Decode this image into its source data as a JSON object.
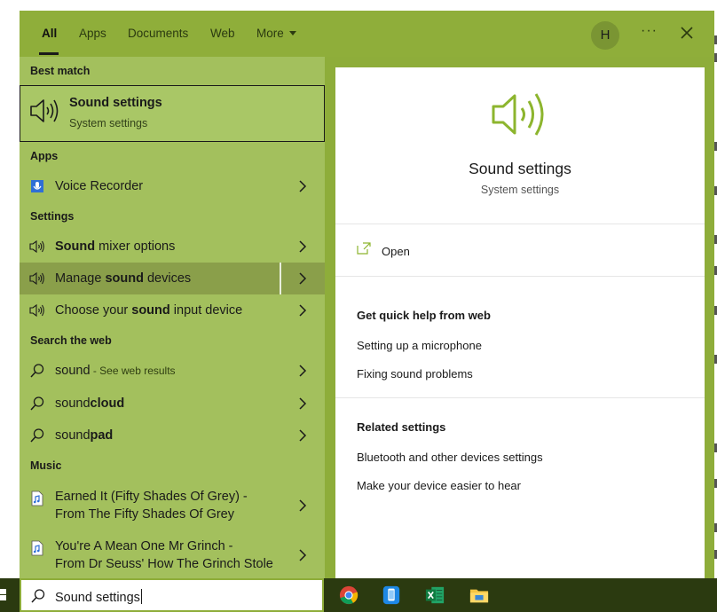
{
  "tabs": [
    {
      "label": "All",
      "active": true
    },
    {
      "label": "Apps"
    },
    {
      "label": "Documents"
    },
    {
      "label": "Web"
    },
    {
      "label": "More"
    }
  ],
  "avatar_initial": "H",
  "sections": {
    "best_match": "Best match",
    "apps": "Apps",
    "settings": "Settings",
    "search_web": "Search the web",
    "music": "Music"
  },
  "best_match": {
    "title": "Sound settings",
    "subtitle": "System settings"
  },
  "apps": [
    {
      "label": "Voice Recorder",
      "icon": "voice-recorder-icon"
    }
  ],
  "settings": [
    {
      "bold": "Sound",
      "rest": " mixer options",
      "pre": ""
    },
    {
      "pre": "Manage ",
      "bold": "sound",
      "rest": " devices",
      "highlighted": true
    },
    {
      "pre": "Choose your ",
      "bold": "sound",
      "rest": " input device"
    }
  ],
  "web": [
    {
      "pre": "sound",
      "bold": "",
      "sub": " - See web results"
    },
    {
      "pre": "sound",
      "bold": "cloud"
    },
    {
      "pre": "sound",
      "bold": "pad"
    }
  ],
  "music": [
    {
      "line1": "Earned It (Fifty Shades Of Grey) -",
      "line2": "From The Fifty Shades Of Grey"
    },
    {
      "line1": "You're A Mean One Mr Grinch -",
      "line2": "From Dr Seuss' How The Grinch Stole"
    }
  ],
  "preview": {
    "title": "Sound settings",
    "subtitle": "System settings",
    "open_label": "Open",
    "quick_help_heading": "Get quick help from web",
    "quick_help_links": [
      "Setting up a microphone",
      "Fixing sound problems"
    ],
    "related_heading": "Related settings",
    "related_links": [
      "Bluetooth and other devices settings",
      "Make your device easier to hear"
    ]
  },
  "search": {
    "value": "Sound settings"
  },
  "taskbar_apps": [
    "chrome-icon",
    "phone-icon",
    "excel-icon",
    "file-explorer-icon"
  ],
  "colors": {
    "accent": "#8ead3a",
    "panel": "#a3c05d",
    "highlight": "#8a9f4a",
    "speaker": "#8db52e"
  }
}
